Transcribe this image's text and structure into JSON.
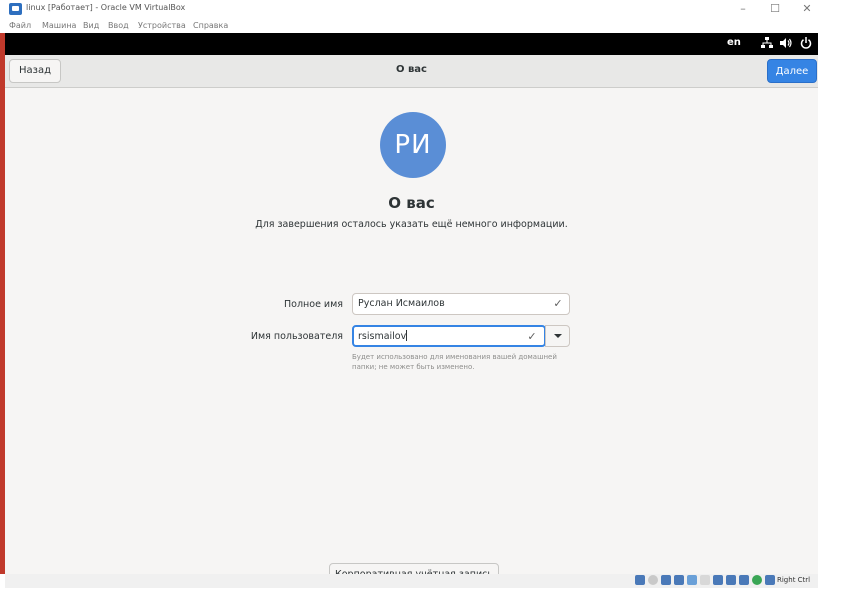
{
  "host": {
    "window_title": "linux [Работает] - Oracle VM VirtualBox",
    "minimize_glyph": "–",
    "maximize_glyph": "☐",
    "close_glyph": "✕",
    "menu": [
      "Файл",
      "Машина",
      "Вид",
      "Ввод",
      "Устройства",
      "Справка"
    ],
    "host_key_label": "Right Ctrl",
    "status_icons": [
      "hdd-icon",
      "optical-icon",
      "audio-icon",
      "network-icon",
      "usb-icon",
      "shared-folder-icon",
      "display-icon",
      "recording-icon",
      "cpu-icon",
      "mouse-integration-icon",
      "keyboard-icon"
    ]
  },
  "guest_topbar": {
    "language": "en",
    "tray_icons": [
      "network-icon",
      "volume-icon",
      "power-icon"
    ]
  },
  "header": {
    "back_label": "Назад",
    "title": "О вас",
    "next_label": "Далее"
  },
  "main": {
    "avatar_initials": "РИ",
    "heading": "О вас",
    "subtitle": "Для завершения осталось указать ещё немного информации.",
    "full_name_label": "Полное имя",
    "full_name_value": "Руслан Исмаилов",
    "username_label": "Имя пользователя",
    "username_value": "rsismailov",
    "username_hint": "Будет использовано для именования вашей домашней папки; не может быть изменено.",
    "enterprise_button_label": "Корпоративная учётная запись"
  },
  "colors": {
    "accent": "#3584e4",
    "avatar": "#5a8ed6",
    "background": "#f6f5f4"
  }
}
